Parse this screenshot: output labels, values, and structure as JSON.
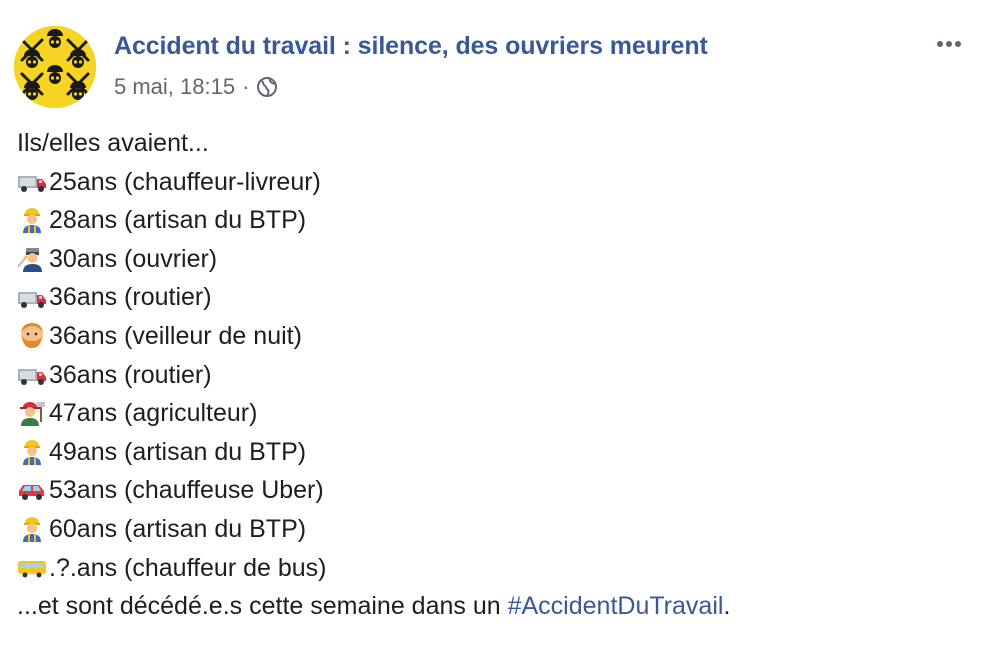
{
  "post": {
    "page_name": "Accident du travail : silence, des ouvriers meurent",
    "timestamp": "5 mai, 18:15",
    "separator": "·",
    "audience_icon": "globe-icon",
    "more_icon": "more-options-icon",
    "intro": "Ils/elles avaient...",
    "lines": [
      {
        "emoji": "delivery-truck-icon",
        "text": "25ans (chauffeur-livreur)"
      },
      {
        "emoji": "construction-worker-icon",
        "text": "28ans (artisan du BTP)"
      },
      {
        "emoji": "factory-worker-icon",
        "text": "30ans (ouvrier)"
      },
      {
        "emoji": "delivery-truck-icon",
        "text": "36ans (routier)"
      },
      {
        "emoji": "bearded-man-icon",
        "text": "36ans (veilleur de nuit)"
      },
      {
        "emoji": "delivery-truck-icon",
        "text": "36ans (routier)"
      },
      {
        "emoji": "farmer-icon",
        "text": "47ans (agriculteur)"
      },
      {
        "emoji": "construction-worker-icon",
        "text": "49ans (artisan du BTP)"
      },
      {
        "emoji": "car-icon",
        "text": "53ans (chauffeuse Uber)"
      },
      {
        "emoji": "construction-worker-icon",
        "text": "60ans (artisan du BTP)"
      },
      {
        "emoji": "bus-icon",
        "text": ".?.ans (chauffeur de bus)"
      }
    ],
    "outro_text": "...et sont décédé.e.s cette semaine dans un ",
    "hashtag": "#AccidentDuTravail",
    "outro_end": "."
  },
  "colors": {
    "link": "#385898",
    "meta": "#616770",
    "text": "#1c1e21",
    "avatar_bg": "#f5d423"
  }
}
